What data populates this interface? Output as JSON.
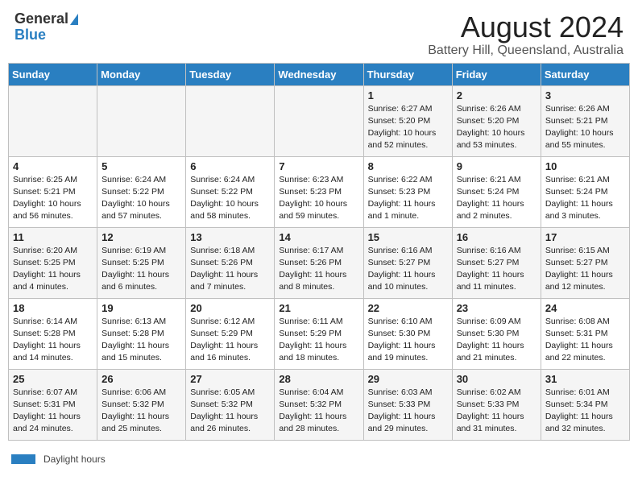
{
  "header": {
    "logo_general": "General",
    "logo_blue": "Blue",
    "title": "August 2024",
    "subtitle": "Battery Hill, Queensland, Australia"
  },
  "days_of_week": [
    "Sunday",
    "Monday",
    "Tuesday",
    "Wednesday",
    "Thursday",
    "Friday",
    "Saturday"
  ],
  "weeks": [
    [
      {
        "day": "",
        "info": ""
      },
      {
        "day": "",
        "info": ""
      },
      {
        "day": "",
        "info": ""
      },
      {
        "day": "",
        "info": ""
      },
      {
        "day": "1",
        "info": "Sunrise: 6:27 AM\nSunset: 5:20 PM\nDaylight: 10 hours and 52 minutes."
      },
      {
        "day": "2",
        "info": "Sunrise: 6:26 AM\nSunset: 5:20 PM\nDaylight: 10 hours and 53 minutes."
      },
      {
        "day": "3",
        "info": "Sunrise: 6:26 AM\nSunset: 5:21 PM\nDaylight: 10 hours and 55 minutes."
      }
    ],
    [
      {
        "day": "4",
        "info": "Sunrise: 6:25 AM\nSunset: 5:21 PM\nDaylight: 10 hours and 56 minutes."
      },
      {
        "day": "5",
        "info": "Sunrise: 6:24 AM\nSunset: 5:22 PM\nDaylight: 10 hours and 57 minutes."
      },
      {
        "day": "6",
        "info": "Sunrise: 6:24 AM\nSunset: 5:22 PM\nDaylight: 10 hours and 58 minutes."
      },
      {
        "day": "7",
        "info": "Sunrise: 6:23 AM\nSunset: 5:23 PM\nDaylight: 10 hours and 59 minutes."
      },
      {
        "day": "8",
        "info": "Sunrise: 6:22 AM\nSunset: 5:23 PM\nDaylight: 11 hours and 1 minute."
      },
      {
        "day": "9",
        "info": "Sunrise: 6:21 AM\nSunset: 5:24 PM\nDaylight: 11 hours and 2 minutes."
      },
      {
        "day": "10",
        "info": "Sunrise: 6:21 AM\nSunset: 5:24 PM\nDaylight: 11 hours and 3 minutes."
      }
    ],
    [
      {
        "day": "11",
        "info": "Sunrise: 6:20 AM\nSunset: 5:25 PM\nDaylight: 11 hours and 4 minutes."
      },
      {
        "day": "12",
        "info": "Sunrise: 6:19 AM\nSunset: 5:25 PM\nDaylight: 11 hours and 6 minutes."
      },
      {
        "day": "13",
        "info": "Sunrise: 6:18 AM\nSunset: 5:26 PM\nDaylight: 11 hours and 7 minutes."
      },
      {
        "day": "14",
        "info": "Sunrise: 6:17 AM\nSunset: 5:26 PM\nDaylight: 11 hours and 8 minutes."
      },
      {
        "day": "15",
        "info": "Sunrise: 6:16 AM\nSunset: 5:27 PM\nDaylight: 11 hours and 10 minutes."
      },
      {
        "day": "16",
        "info": "Sunrise: 6:16 AM\nSunset: 5:27 PM\nDaylight: 11 hours and 11 minutes."
      },
      {
        "day": "17",
        "info": "Sunrise: 6:15 AM\nSunset: 5:27 PM\nDaylight: 11 hours and 12 minutes."
      }
    ],
    [
      {
        "day": "18",
        "info": "Sunrise: 6:14 AM\nSunset: 5:28 PM\nDaylight: 11 hours and 14 minutes."
      },
      {
        "day": "19",
        "info": "Sunrise: 6:13 AM\nSunset: 5:28 PM\nDaylight: 11 hours and 15 minutes."
      },
      {
        "day": "20",
        "info": "Sunrise: 6:12 AM\nSunset: 5:29 PM\nDaylight: 11 hours and 16 minutes."
      },
      {
        "day": "21",
        "info": "Sunrise: 6:11 AM\nSunset: 5:29 PM\nDaylight: 11 hours and 18 minutes."
      },
      {
        "day": "22",
        "info": "Sunrise: 6:10 AM\nSunset: 5:30 PM\nDaylight: 11 hours and 19 minutes."
      },
      {
        "day": "23",
        "info": "Sunrise: 6:09 AM\nSunset: 5:30 PM\nDaylight: 11 hours and 21 minutes."
      },
      {
        "day": "24",
        "info": "Sunrise: 6:08 AM\nSunset: 5:31 PM\nDaylight: 11 hours and 22 minutes."
      }
    ],
    [
      {
        "day": "25",
        "info": "Sunrise: 6:07 AM\nSunset: 5:31 PM\nDaylight: 11 hours and 24 minutes."
      },
      {
        "day": "26",
        "info": "Sunrise: 6:06 AM\nSunset: 5:32 PM\nDaylight: 11 hours and 25 minutes."
      },
      {
        "day": "27",
        "info": "Sunrise: 6:05 AM\nSunset: 5:32 PM\nDaylight: 11 hours and 26 minutes."
      },
      {
        "day": "28",
        "info": "Sunrise: 6:04 AM\nSunset: 5:32 PM\nDaylight: 11 hours and 28 minutes."
      },
      {
        "day": "29",
        "info": "Sunrise: 6:03 AM\nSunset: 5:33 PM\nDaylight: 11 hours and 29 minutes."
      },
      {
        "day": "30",
        "info": "Sunrise: 6:02 AM\nSunset: 5:33 PM\nDaylight: 11 hours and 31 minutes."
      },
      {
        "day": "31",
        "info": "Sunrise: 6:01 AM\nSunset: 5:34 PM\nDaylight: 11 hours and 32 minutes."
      }
    ]
  ],
  "legend": {
    "label": "Daylight hours"
  }
}
